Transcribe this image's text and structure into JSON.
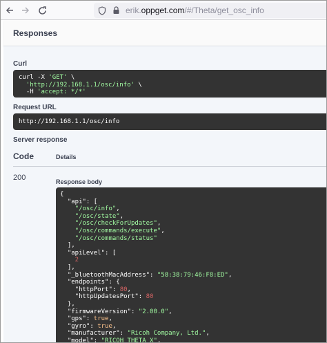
{
  "browser": {
    "url_prefix": "erik.",
    "url_host": "oppget.com",
    "url_path": "/#/Theta/get_osc_info"
  },
  "responses": {
    "title": "Responses",
    "curl_label": "Curl",
    "curl_lines": [
      "curl -X ",
      "'GET'",
      " \\",
      "  ",
      "'http://192.168.1.1/osc/info'",
      " \\",
      "  -H ",
      "'accept: */*'"
    ],
    "request_url_label": "Request URL",
    "request_url": "http://192.168.1.1/osc/info",
    "server_response_label": "Server response",
    "col_code": "Code",
    "col_details": "Details",
    "status_code": "200",
    "response_body_label": "Response body"
  },
  "response_json": [
    [
      [
        "p",
        "{"
      ]
    ],
    [
      [
        "p",
        "  \"api\": ["
      ]
    ],
    [
      [
        "s",
        "    \"/osc/info\""
      ],
      [
        "p",
        ","
      ]
    ],
    [
      [
        "s",
        "    \"/osc/state\""
      ],
      [
        "p",
        ","
      ]
    ],
    [
      [
        "s",
        "    \"/osc/checkForUpdates\""
      ],
      [
        "p",
        ","
      ]
    ],
    [
      [
        "s",
        "    \"/osc/commands/execute\""
      ],
      [
        "p",
        ","
      ]
    ],
    [
      [
        "s",
        "    \"/osc/commands/status\""
      ]
    ],
    [
      [
        "p",
        "  ],"
      ]
    ],
    [
      [
        "p",
        "  \"apiLevel\": ["
      ]
    ],
    [
      [
        "n",
        "    2"
      ]
    ],
    [
      [
        "p",
        "  ],"
      ]
    ],
    [
      [
        "p",
        "  \"_bluetoothMacAddress\": "
      ],
      [
        "s",
        "\"58:38:79:46:F8:ED\""
      ],
      [
        "p",
        ","
      ]
    ],
    [
      [
        "p",
        "  \"endpoints\": {"
      ]
    ],
    [
      [
        "p",
        "    \"httpPort\": "
      ],
      [
        "n",
        "80"
      ],
      [
        "p",
        ","
      ]
    ],
    [
      [
        "p",
        "    \"httpUpdatesPort\": "
      ],
      [
        "n",
        "80"
      ]
    ],
    [
      [
        "p",
        "  },"
      ]
    ],
    [
      [
        "p",
        "  \"firmwareVersion\": "
      ],
      [
        "s",
        "\"2.00.0\""
      ],
      [
        "p",
        ","
      ]
    ],
    [
      [
        "p",
        "  \"gps\": "
      ],
      [
        "k",
        "true"
      ],
      [
        "p",
        ","
      ]
    ],
    [
      [
        "p",
        "  \"gyro\": "
      ],
      [
        "k",
        "true"
      ],
      [
        "p",
        ","
      ]
    ],
    [
      [
        "p",
        "  \"manufacturer\": "
      ],
      [
        "s",
        "\"Ricoh Company, Ltd.\""
      ],
      [
        "p",
        ","
      ]
    ],
    [
      [
        "p",
        "  \"model\": "
      ],
      [
        "s",
        "\"RICOH THETA X\""
      ],
      [
        "p",
        ","
      ]
    ]
  ],
  "colors": {
    "code_bg": "#333333",
    "string": "#a2fca2",
    "number": "#d36363",
    "keyword": "#fcc28c"
  }
}
